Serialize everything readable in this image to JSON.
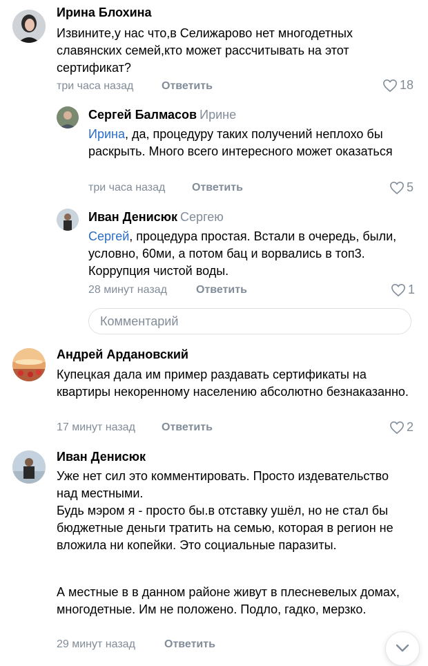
{
  "comments": [
    {
      "author": "Ирина Блохина",
      "text": "Извините,у нас что,в Селижарово нет многодетных славянских семей,кто может рассчитывать на этот сертификат?",
      "time": "три часа назад",
      "reply_label": "Ответить",
      "likes": "18"
    },
    {
      "author": "Сергей Балмасов",
      "reply_to": "Ирине",
      "mention": "Ирина",
      "text": ", да, процедуру таких получений неплохо бы раскрыть. Много всего интересного может оказаться",
      "time": "три часа назад",
      "reply_label": "Ответить",
      "likes": "5"
    },
    {
      "author": "Иван Денисюк",
      "reply_to": "Сергею",
      "mention": "Сергей",
      "text": ", процедура простая. Встали в очередь, были, условно, 60ми, а потом бац и ворвались в топ3. Коррупция чистой воды.",
      "time": "28 минут назад",
      "reply_label": "Ответить",
      "likes": "1"
    },
    {
      "author": "Андрей Ардановский",
      "text": "Купецкая дала им пример раздавать сертификаты на квартиры некоренному населению абсолютно безнаказанно.",
      "time": "17 минут назад",
      "reply_label": "Ответить",
      "likes": "2"
    },
    {
      "author": "Иван Денисюк",
      "paragraphs": [
        "Уже нет сил это комментировать. Просто издевательство над местными.",
        "Будь мэром я - просто бы.в отставку ушёл, но не стал бы бюджетные деньги тратить на семью, которая в регион не вложила ни копейки. Это социальные паразиты.",
        "А местные в в данном районе живут в плесневелых домах, многодетные. Им не положено. Подло, гадко, мерзко."
      ],
      "time": "29 минут назад",
      "reply_label": "Ответить"
    }
  ],
  "reply_input": {
    "placeholder": "Комментарий"
  },
  "icons": {
    "like": "heart-outline-icon",
    "scroll": "chevron-down-icon"
  },
  "colors": {
    "accent": "#2a6dc5",
    "secondary_text": "#818c99",
    "border": "#dce1e6"
  }
}
